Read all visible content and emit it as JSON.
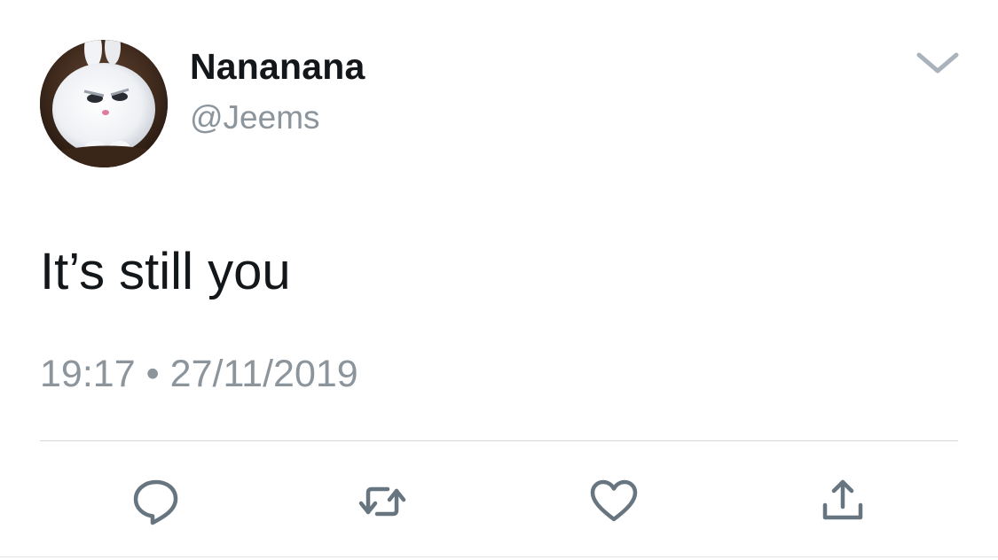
{
  "user": {
    "display_name": "Nananana",
    "handle": "@Jeems",
    "avatar_icon": "white-bunny-avatar"
  },
  "tweet": {
    "text": "It’s still you",
    "time": "19:17",
    "separator": "•",
    "date": "27/11/2019"
  },
  "icons": {
    "menu": "chevron-down-icon",
    "reply": "reply-bubble-icon",
    "retweet": "retweet-icon",
    "like": "heart-icon",
    "share": "share-upload-icon"
  },
  "colors": {
    "text_primary": "#14171a",
    "text_secondary": "#8c949c",
    "icon_gray": "#66757f",
    "divider": "#d4d8dc"
  }
}
